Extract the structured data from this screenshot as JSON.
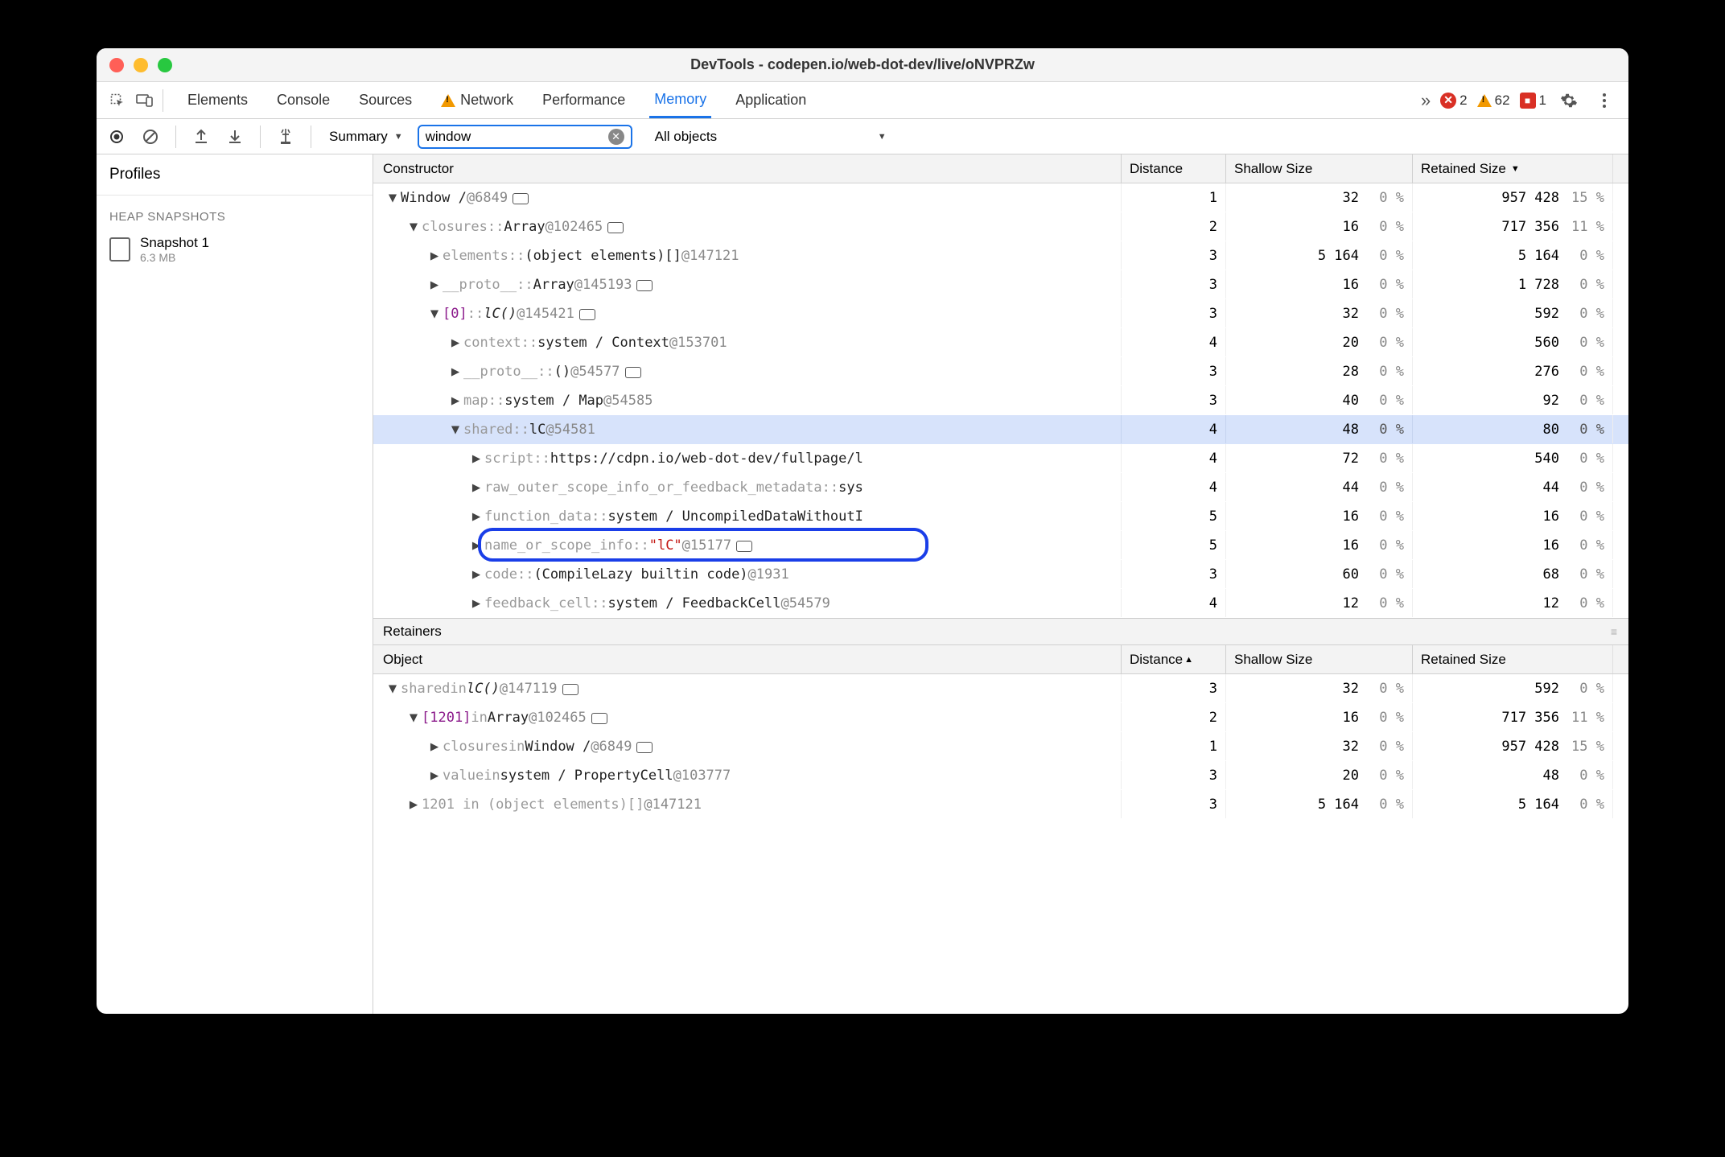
{
  "window_title": "DevTools - codepen.io/web-dot-dev/live/oNVPRZw",
  "tabs": [
    "Elements",
    "Console",
    "Sources",
    "Network",
    "Performance",
    "Memory",
    "Application"
  ],
  "active_tab": "Memory",
  "warn_tab": "Network",
  "counts": {
    "errors": "2",
    "warnings": "62",
    "issues": "1"
  },
  "toolbar": {
    "view": "Summary",
    "filter_value": "window",
    "objects_scope": "All objects"
  },
  "profiles": {
    "header": "Profiles",
    "section": "HEAP SNAPSHOTS",
    "items": [
      {
        "name": "Snapshot 1",
        "size": "6.3 MB"
      }
    ]
  },
  "columns": {
    "constructor": "Constructor",
    "distance": "Distance",
    "shallow": "Shallow Size",
    "retained": "Retained Size",
    "object": "Object"
  },
  "topRows": [
    {
      "indent": 0,
      "open": true,
      "prop": "",
      "sep": "",
      "cls": "Window /",
      "id": "@6849",
      "link": true,
      "dist": "1",
      "sh": "32",
      "shp": "0 %",
      "rt": "957 428",
      "rtp": "15 %"
    },
    {
      "indent": 1,
      "open": true,
      "prop": "closures",
      "sep": " :: ",
      "cls": "Array",
      "id": "@102465",
      "link": true,
      "dist": "2",
      "sh": "16",
      "shp": "0 %",
      "rt": "717 356",
      "rtp": "11 %"
    },
    {
      "indent": 2,
      "open": false,
      "prop": "elements",
      "sep": " :: ",
      "cls": "(object elements)[]",
      "id": "@147121",
      "dist": "3",
      "sh": "5 164",
      "shp": "0 %",
      "rt": "5 164",
      "rtp": "0 %"
    },
    {
      "indent": 2,
      "open": false,
      "prop": "__proto__",
      "sep": " :: ",
      "cls": "Array",
      "id": "@145193",
      "link": true,
      "dist": "3",
      "sh": "16",
      "shp": "0 %",
      "rt": "1 728",
      "rtp": "0 %"
    },
    {
      "indent": 2,
      "open": true,
      "idx": "[0]",
      "sep": " :: ",
      "cls_i": "lC()",
      "id": "@145421",
      "link": true,
      "dist": "3",
      "sh": "32",
      "shp": "0 %",
      "rt": "592",
      "rtp": "0 %"
    },
    {
      "indent": 3,
      "open": false,
      "prop": "context",
      "sep": " :: ",
      "cls": "system / Context",
      "id": "@153701",
      "dist": "4",
      "sh": "20",
      "shp": "0 %",
      "rt": "560",
      "rtp": "0 %"
    },
    {
      "indent": 3,
      "open": false,
      "prop": "__proto__",
      "sep": " :: ",
      "cls": "()",
      "id": "@54577",
      "link": true,
      "dist": "3",
      "sh": "28",
      "shp": "0 %",
      "rt": "276",
      "rtp": "0 %"
    },
    {
      "indent": 3,
      "open": false,
      "prop": "map",
      "sep": " :: ",
      "cls": "system / Map",
      "id": "@54585",
      "dist": "3",
      "sh": "40",
      "shp": "0 %",
      "rt": "92",
      "rtp": "0 %"
    },
    {
      "indent": 3,
      "open": true,
      "prop": "shared",
      "sep": " :: ",
      "cls": "lC",
      "id": "@54581",
      "dist": "4",
      "sh": "48",
      "shp": "0 %",
      "rt": "80",
      "rtp": "0 %",
      "selected": true
    },
    {
      "indent": 4,
      "open": false,
      "prop": "script",
      "sep": " :: ",
      "cls": "https://cdpn.io/web-dot-dev/fullpage/l",
      "dist": "4",
      "sh": "72",
      "shp": "0 %",
      "rt": "540",
      "rtp": "0 %"
    },
    {
      "indent": 4,
      "open": false,
      "prop": "raw_outer_scope_info_or_feedback_metadata",
      "sep": " :: ",
      "cls": "sys",
      "dist": "4",
      "sh": "44",
      "shp": "0 %",
      "rt": "44",
      "rtp": "0 %"
    },
    {
      "indent": 4,
      "open": false,
      "prop": "function_data",
      "sep": " :: ",
      "cls": "system / UncompiledDataWithoutI",
      "dist": "5",
      "sh": "16",
      "shp": "0 %",
      "rt": "16",
      "rtp": "0 %"
    },
    {
      "indent": 4,
      "open": false,
      "prop": "name_or_scope_info",
      "sep": " :: ",
      "str": "\"lC\"",
      "id": "@15177",
      "link": true,
      "dist": "5",
      "sh": "16",
      "shp": "0 %",
      "rt": "16",
      "rtp": "0 %",
      "ring": true
    },
    {
      "indent": 4,
      "open": false,
      "prop": "code",
      "sep": " :: ",
      "cls": "(CompileLazy builtin code)",
      "id": "@1931",
      "dist": "3",
      "sh": "60",
      "shp": "0 %",
      "rt": "68",
      "rtp": "0 %"
    },
    {
      "indent": 4,
      "open": false,
      "prop": "feedback_cell",
      "sep": " :: ",
      "cls": "system / FeedbackCell",
      "id": "@54579",
      "dist": "4",
      "sh": "12",
      "shp": "0 %",
      "rt": "12",
      "rtp": "0 %"
    }
  ],
  "retainers_label": "Retainers",
  "retainerRows": [
    {
      "indent": 0,
      "open": true,
      "prop": "shared",
      "mid": " in ",
      "cls_i": "lC()",
      "id": "@147119",
      "link": true,
      "dist": "3",
      "sh": "32",
      "shp": "0 %",
      "rt": "592",
      "rtp": "0 %"
    },
    {
      "indent": 1,
      "open": true,
      "idx": "[1201]",
      "mid": " in ",
      "cls": "Array",
      "id": "@102465",
      "link": true,
      "dist": "2",
      "sh": "16",
      "shp": "0 %",
      "rt": "717 356",
      "rtp": "11 %"
    },
    {
      "indent": 2,
      "open": false,
      "prop": "closures",
      "mid": " in ",
      "cls": "Window /",
      "id": "@6849",
      "link": true,
      "dist": "1",
      "sh": "32",
      "shp": "0 %",
      "rt": "957 428",
      "rtp": "15 %"
    },
    {
      "indent": 2,
      "open": false,
      "prop": "value",
      "mid": " in ",
      "cls": "system / PropertyCell",
      "id": "@103777",
      "dist": "3",
      "sh": "20",
      "shp": "0 %",
      "rt": "48",
      "rtp": "0 %"
    },
    {
      "indent": 1,
      "open": false,
      "raw": "1201 in (object elements)[]",
      "id": "@147121",
      "dist": "3",
      "sh": "5 164",
      "shp": "0 %",
      "rt": "5 164",
      "rtp": "0 %"
    }
  ]
}
